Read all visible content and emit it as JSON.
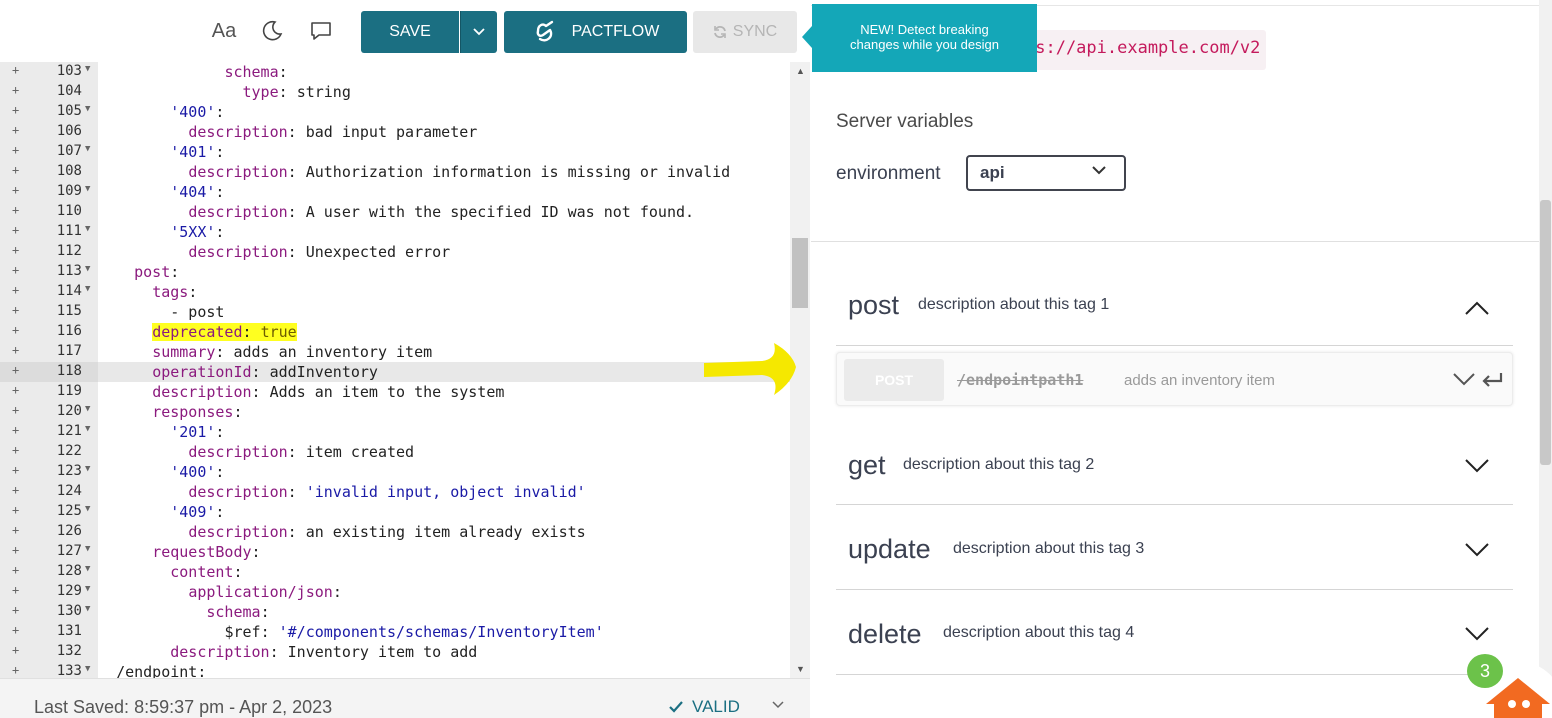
{
  "toolbar": {
    "font_size_label": "Aa",
    "save_label": "SAVE",
    "pactflow_label": "PACTFLOW",
    "sync_label": "SYNC"
  },
  "tooltip": {
    "line1": "NEW! Detect breaking",
    "line2": "changes while you design"
  },
  "editor": {
    "active_line": 118,
    "highlighted_line": 116,
    "lines": [
      {
        "n": "103",
        "fold": true,
        "indent": 14,
        "key": "schema",
        "val": ""
      },
      {
        "n": "104",
        "fold": false,
        "indent": 16,
        "key": "type",
        "val": "string"
      },
      {
        "n": "105",
        "fold": true,
        "indent": 8,
        "str": "'400'",
        "val": ""
      },
      {
        "n": "106",
        "fold": false,
        "indent": 10,
        "key": "description",
        "val": "bad input parameter"
      },
      {
        "n": "107",
        "fold": true,
        "indent": 8,
        "str": "'401'",
        "val": ""
      },
      {
        "n": "108",
        "fold": false,
        "indent": 10,
        "key": "description",
        "val": "Authorization information is missing or invalid"
      },
      {
        "n": "109",
        "fold": true,
        "indent": 8,
        "str": "'404'",
        "val": ""
      },
      {
        "n": "110",
        "fold": false,
        "indent": 10,
        "key": "description",
        "val": "A user with the specified ID was not found."
      },
      {
        "n": "111",
        "fold": true,
        "indent": 8,
        "str": "'5XX'",
        "val": ""
      },
      {
        "n": "112",
        "fold": false,
        "indent": 10,
        "key": "description",
        "val": "Unexpected error"
      },
      {
        "n": "113",
        "fold": true,
        "indent": 4,
        "key": "post",
        "val": ""
      },
      {
        "n": "114",
        "fold": true,
        "indent": 6,
        "key": "tags",
        "val": ""
      },
      {
        "n": "115",
        "fold": false,
        "indent": 8,
        "plain": "- post"
      },
      {
        "n": "116",
        "fold": false,
        "indent": 6,
        "key": "deprecated",
        "val": "true"
      },
      {
        "n": "117",
        "fold": false,
        "indent": 6,
        "key": "summary",
        "val": "adds an inventory item"
      },
      {
        "n": "118",
        "fold": false,
        "indent": 6,
        "key": "operationId",
        "val": "addInventory"
      },
      {
        "n": "119",
        "fold": false,
        "indent": 6,
        "key": "description",
        "val": "Adds an item to the system"
      },
      {
        "n": "120",
        "fold": true,
        "indent": 6,
        "key": "responses",
        "val": ""
      },
      {
        "n": "121",
        "fold": true,
        "indent": 8,
        "str": "'201'",
        "val": ""
      },
      {
        "n": "122",
        "fold": false,
        "indent": 10,
        "key": "description",
        "val": "item created"
      },
      {
        "n": "123",
        "fold": true,
        "indent": 8,
        "str": "'400'",
        "val": ""
      },
      {
        "n": "124",
        "fold": false,
        "indent": 10,
        "key": "description",
        "sval": "'invalid input, object invalid'"
      },
      {
        "n": "125",
        "fold": true,
        "indent": 8,
        "str": "'409'",
        "val": ""
      },
      {
        "n": "126",
        "fold": false,
        "indent": 10,
        "key": "description",
        "val": "an existing item already exists"
      },
      {
        "n": "127",
        "fold": true,
        "indent": 6,
        "key": "requestBody",
        "val": ""
      },
      {
        "n": "128",
        "fold": true,
        "indent": 8,
        "key": "content",
        "val": ""
      },
      {
        "n": "129",
        "fold": true,
        "indent": 10,
        "key": "application/json",
        "val": ""
      },
      {
        "n": "130",
        "fold": true,
        "indent": 12,
        "key": "schema",
        "val": ""
      },
      {
        "n": "131",
        "fold": false,
        "indent": 14,
        "dkey": "$ref",
        "sval": "'#/components/schemas/InventoryItem'"
      },
      {
        "n": "132",
        "fold": false,
        "indent": 8,
        "key": "description",
        "val": "Inventory item to add"
      },
      {
        "n": "133",
        "fold": true,
        "indent": 2,
        "dkey": "/endpoint",
        "val": ""
      }
    ]
  },
  "status": {
    "last_saved": "Last Saved:  8:59:37 pm   -   Apr 2, 2023",
    "valid_label": "VALID"
  },
  "preview": {
    "server_url": "ps://api.example.com/v2",
    "server_variables_title": "Server variables",
    "env_label": "environment",
    "env_value": "api",
    "tags": [
      {
        "name": "post",
        "description": "description about this tag 1"
      },
      {
        "name": "get",
        "description": "description about this tag 2"
      },
      {
        "name": "update",
        "description": "description about this tag 3"
      },
      {
        "name": "delete",
        "description": "description about this tag 4"
      }
    ],
    "operation": {
      "method": "POST",
      "path": "/endpointpath1",
      "summary": "adds an inventory item"
    }
  },
  "notification_count": "3",
  "colors": {
    "accent": "#1b6f82",
    "tooltip": "#14a7b8",
    "highlight": "#ffff20",
    "yaml_key": "#8b1a7e",
    "yaml_string": "#1a1aa6",
    "badge": "#6cc24a",
    "fab": "#f26a21"
  }
}
